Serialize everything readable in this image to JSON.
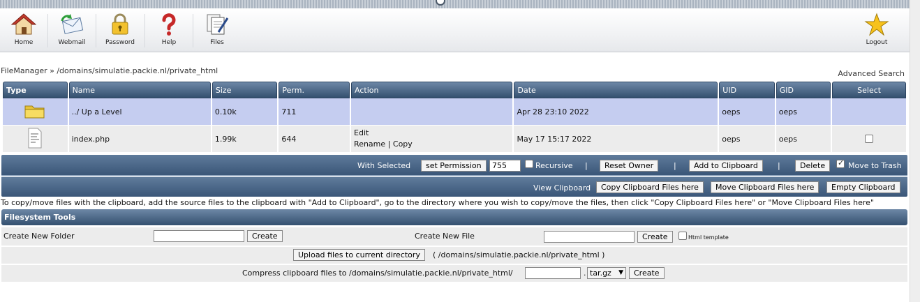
{
  "toolbar": {
    "items": [
      {
        "label": "Home",
        "icon": "house-icon"
      },
      {
        "label": "Webmail",
        "icon": "envelope-icon"
      },
      {
        "label": "Password",
        "icon": "lock-icon"
      },
      {
        "label": "Help",
        "icon": "question-icon"
      },
      {
        "label": "Files",
        "icon": "files-icon"
      }
    ],
    "logout": {
      "label": "Logout",
      "icon": "star-icon"
    }
  },
  "breadcrumb": "FileManager » /domains/simulatie.packie.nl/private_html",
  "advanced_search": "Advanced Search",
  "table": {
    "headers": [
      "Type",
      "Name",
      "Size",
      "Perm.",
      "Action",
      "Date",
      "UID",
      "GID",
      "Select"
    ],
    "rows": [
      {
        "type_icon": "folder-icon",
        "name": "../ Up a Level",
        "size": "0.10k",
        "perm": "711",
        "date": "Apr 28 23:10 2022",
        "uid": "oeps",
        "gid": "oeps"
      },
      {
        "type_icon": "document-icon",
        "name": "index.php",
        "size": "1.99k",
        "perm": "644",
        "action_edit": "Edit",
        "action_rename": "Rename",
        "action_sep": "|",
        "action_copy": "Copy",
        "date": "May 17 15:17 2022",
        "uid": "oeps",
        "gid": "oeps"
      }
    ]
  },
  "selected_bar": {
    "with_selected": "With Selected",
    "set_permission": "set Permission",
    "permission_value": "755",
    "recursive": "Recursive",
    "sep": "|",
    "reset_owner": "Reset Owner",
    "add_to_clipboard": "Add to Clipboard",
    "delete": "Delete",
    "move_to_trash": "Move to Trash",
    "move_to_trash_checked": true
  },
  "clipboard_bar": {
    "view_clipboard": "View Clipboard",
    "copy_here": "Copy Clipboard Files here",
    "move_here": "Move Clipboard Files here",
    "empty": "Empty Clipboard"
  },
  "clipboard_note": "To copy/move files with the clipboard, add the source files to the clipboard with \"Add to Clipboard\", go to the directory where you wish to copy/move the files, then click \"Copy Clipboard Files here\" or \"Move Clipboard Files here\"",
  "fs_tools": {
    "title": "Filesystem Tools",
    "create_folder_label": "Create New Folder",
    "create_file_label": "Create New File",
    "create": "Create",
    "html_template": "Html template",
    "upload_button": "Upload files to current directory",
    "upload_path": "( /domains/simulatie.packie.nl/private_html )",
    "compress_label": "Compress clipboard files to /domains/simulatie.packie.nl/private_html/",
    "ext_dot": ".",
    "compress_format": "tar.gz"
  },
  "colors": {
    "header_dark": "#34506f",
    "header_light": "#6d87a6",
    "updir_row": "#c5cdf0",
    "file_row": "#ececec"
  }
}
